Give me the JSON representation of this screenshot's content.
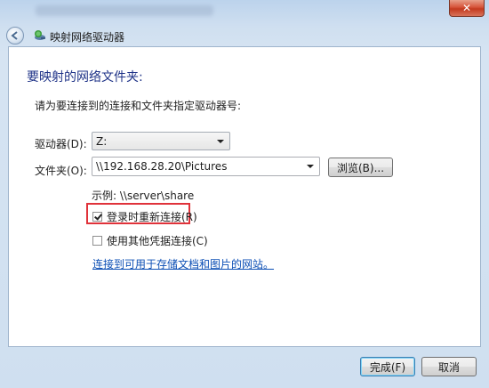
{
  "window": {
    "close_glyph": "✕",
    "nav_title": "映射网络驱动器"
  },
  "content": {
    "heading": "要映射的网络文件夹:",
    "instruction": "请为要连接到的连接和文件夹指定驱动器号:",
    "drive_label": "驱动器(D):",
    "drive_value": "Z:",
    "folder_label": "文件夹(O):",
    "folder_value": "\\\\192.168.28.20\\Pictures",
    "browse_label": "浏览(B)...",
    "example": "示例: \\\\server\\share",
    "reconnect_label": "登录时重新连接(R)",
    "reconnect_checked": true,
    "credentials_label": "使用其他凭据连接(C)",
    "credentials_checked": false,
    "link_text": "连接到可用于存储文档和图片的网站。"
  },
  "footer": {
    "finish_label": "完成(F)",
    "cancel_label": "取消"
  },
  "colors": {
    "heading": "#1e3287",
    "link": "#0c4fb5",
    "highlight": "#e0323a",
    "close_button": "#c33a1f"
  }
}
